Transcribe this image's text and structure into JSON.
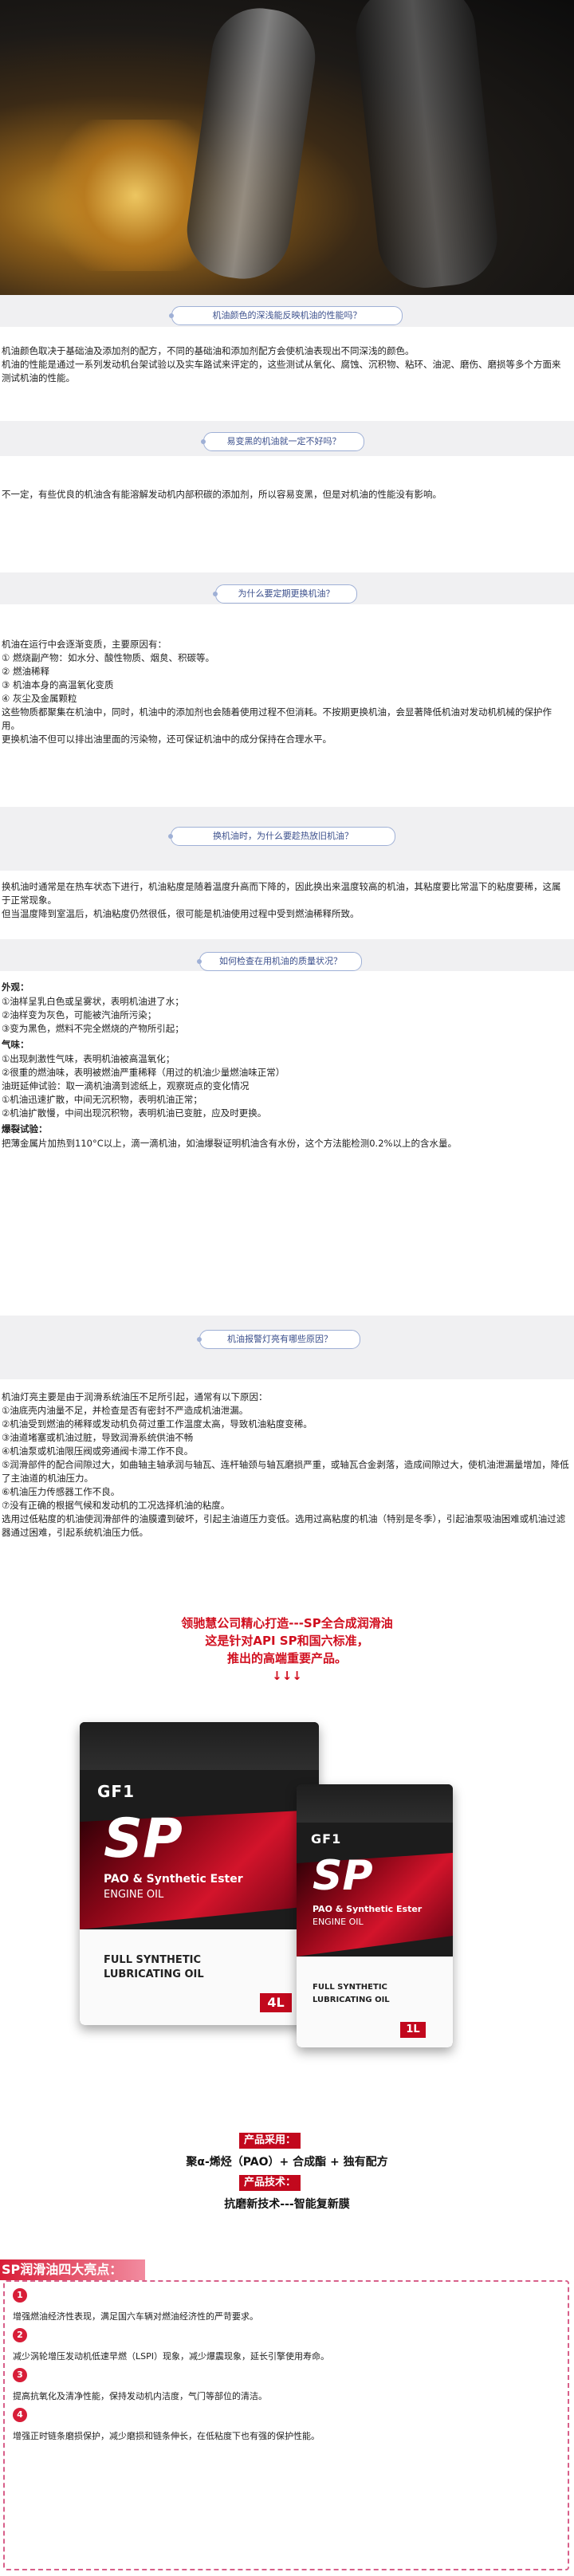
{
  "questions": {
    "q1": "机油颜色的深浅能反映机油的性能吗？",
    "q2": "易变黑的机油就一定不好吗？",
    "q3": "为什么要定期更换机油？",
    "q4": "换机油时，为什么要趁热放旧机油？",
    "q5": "如何检查在用机油的质量状况？",
    "q6": "机油报警灯亮有哪些原因？"
  },
  "sections": {
    "s1": "机油颜色取决于基础油及添加剂的配方，不同的基础油和添加剂配方会使机油表现出不同深浅的颜色。\n机油的性能是通过一系列发动机台架试验以及实车路试来评定的，这些测试从氧化、腐蚀、沉积物、粘环、油泥、磨伤、磨损等多个方面来测试机油的性能。",
    "s2": "不一定，有些优良的机油含有能溶解发动机内部积碳的添加剂，所以容易变黑，但是对机油的性能没有影响。",
    "s3": "机油在运行中会逐渐变质，主要原因有：\n① 燃烧副产物：如水分、酸性物质、烟炱、积碳等。\n② 燃油稀释\n③ 机油本身的高温氧化变质\n④ 灰尘及金属颗粒\n这些物质都聚集在机油中，同时，机油中的添加剂也会随着使用过程不但消耗。不按期更换机油，会显著降低机油对发动机机械的保护作用。\n更换机油不但可以排出油里面的污染物，还可保证机油中的成分保持在合理水平。",
    "s4": "换机油时通常是在热车状态下进行，机油粘度是随着温度升高而下降的，因此换出来温度较高的机油，其粘度要比常温下的粘度要稀，这属于正常现象。\n但当温度降到室温后，机油粘度仍然很低，很可能是机油使用过程中受到燃油稀释所致。",
    "s5_h1": "外观：",
    "s5_a": "①油样呈乳白色或呈雾状，表明机油进了水；\n②油样变为灰色，可能被汽油所污染；\n③变为黑色，燃料不完全燃烧的产物所引起；",
    "s5_h2": "气味：",
    "s5_b": "①出现刺激性气味，表明机油被高温氧化；\n②很重的燃油味，表明被燃油严重稀释（用过的机油少量燃油味正常）\n油斑延伸试验：取一滴机油滴到滤纸上，观察斑点的变化情况\n①机油迅速扩散，中间无沉积物，表明机油正常；\n②机油扩散慢，中间出现沉积物，表明机油已变脏，应及时更换。",
    "s5_h3": "爆裂试验：",
    "s5_c": "把薄金属片加热到110°C以上，滴一滴机油，如油爆裂证明机油含有水份，这个方法能检测0.2%以上的含水量。",
    "s6": "机油灯亮主要是由于润滑系统油压不足所引起，通常有以下原因：\n①油底壳内油量不足，并检查是否有密封不严造成机油泄漏。\n②机油受到燃油的稀释或发动机负荷过重工作温度太高，导致机油粘度变稀。\n③油道堵塞或机油过脏，导致润滑系统供油不畅\n④机油泵或机油限压阀或旁通阀卡滞工作不良。\n⑤润滑部件的配合间隙过大，如曲轴主轴承润与轴瓦、连杆轴颈与轴瓦磨损严重，或轴瓦合金剥落，造成间隙过大，使机油泄漏量增加，降低了主油道的机油压力。\n⑥机油压力传感器工作不良。\n⑦没有正确的根据气候和发动机的工况选择机油的粘度。\n选用过低粘度的机油使润滑部件的油膜遭到破坏，引起主油道压力变低。选用过高粘度的机油（特别是冬季），引起油泵吸油困难或机油过滤器通过困难，引起系统机油压力低。"
  },
  "promo": {
    "line1": "领驰慧公司精心打造---SP全合成润滑油",
    "line2": "这是针对API SP和国六标准，",
    "line3": "推出的高端重要产品。",
    "arrows": "↓↓↓"
  },
  "product": {
    "brand": "GF1",
    "sp": "SP",
    "pao": "PAO & Synthetic Ester",
    "engine": "ENGINE OIL",
    "full1": "FULL SYNTHETIC",
    "full2": "LUBRICATING OIL",
    "vol_big": "4L",
    "vol_small": "1L",
    "tag1": "产品采用：",
    "formula": "聚α-烯烃（PAO）+ 合成酯 + 独有配方",
    "tag2": "产品技术：",
    "tech": "抗磨新技术---智能复新膜"
  },
  "features": {
    "title": "SP润滑油四大亮点：",
    "items": [
      {
        "num": "1",
        "text": "增强燃油经济性表现，满足国六车辆对燃油经济性的严苛要求。"
      },
      {
        "num": "2",
        "text": "减少涡轮增压发动机低速早燃（LSPI）现象，减少爆震现象，延长引擎使用寿命。"
      },
      {
        "num": "3",
        "text": "提高抗氧化及清净性能，保持发动机内洁度，气门等部位的清洁。"
      },
      {
        "num": "4",
        "text": "增强正时链条磨损保护，减少磨损和链条伸长，在低粘度下也有强的保护性能。"
      }
    ]
  },
  "colors": {
    "accent": "#d10f1f",
    "pill_border": "#9fb0d6",
    "band": "#f0f0f2"
  }
}
